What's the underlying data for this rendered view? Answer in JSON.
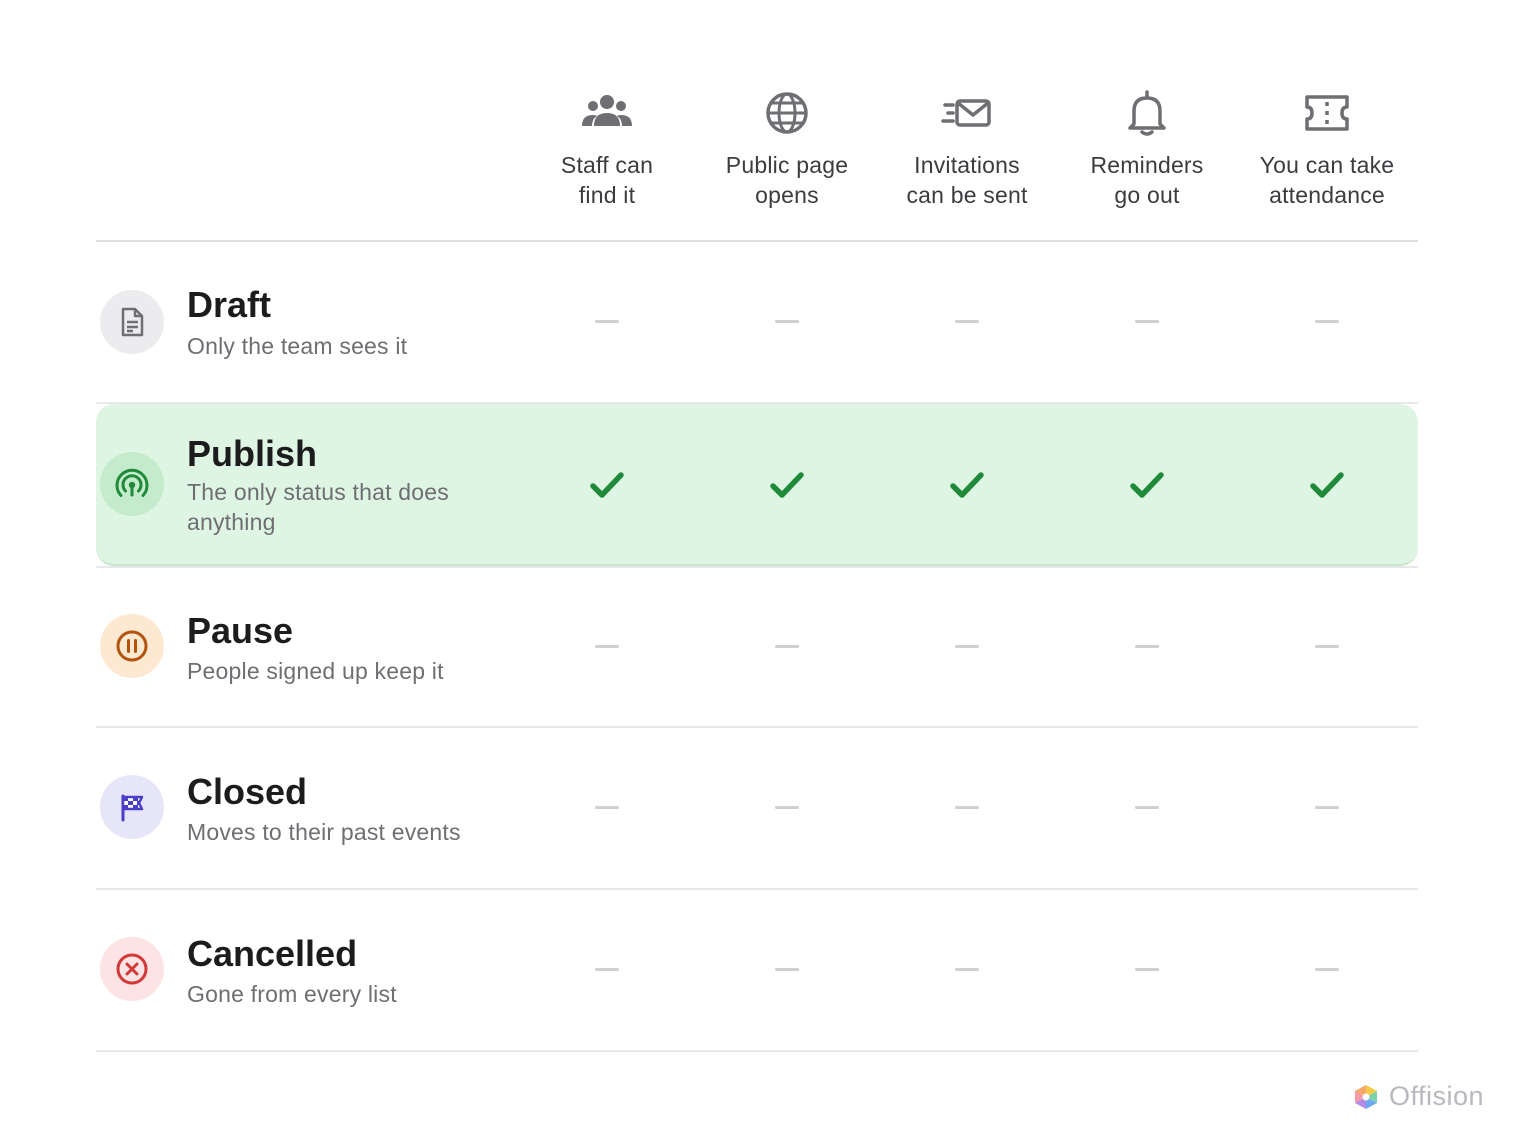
{
  "columns": [
    {
      "label_line1": "Staff can",
      "label_line2": "find it",
      "icon": "people-icon"
    },
    {
      "label_line1": "Public page",
      "label_line2": "opens",
      "icon": "globe-icon"
    },
    {
      "label_line1": "Invitations",
      "label_line2": "can be sent",
      "icon": "mail-send-icon"
    },
    {
      "label_line1": "Reminders",
      "label_line2": "go out",
      "icon": "bell-icon"
    },
    {
      "label_line1": "You can take",
      "label_line2": "attendance",
      "icon": "ticket-icon"
    }
  ],
  "rows": [
    {
      "name": "Draft",
      "description": "Only the team sees it",
      "icon": "document-icon",
      "icon_color": "#6e6e73",
      "icon_bg": "#ececee",
      "values": [
        false,
        false,
        false,
        false,
        false
      ],
      "highlighted": false
    },
    {
      "name": "Publish",
      "description": "The only status that does anything",
      "icon": "broadcast-icon",
      "icon_color": "#1f8a3a",
      "icon_bg": "#c4ebcc",
      "values": [
        true,
        true,
        true,
        true,
        true
      ],
      "highlighted": true
    },
    {
      "name": "Pause",
      "description": "People signed up keep it",
      "icon": "pause-icon",
      "icon_color": "#b3540e",
      "icon_bg": "#fde9d2",
      "values": [
        false,
        false,
        false,
        false,
        false
      ],
      "highlighted": false
    },
    {
      "name": "Closed",
      "description": "Moves to their past events",
      "icon": "checkered-flag-icon",
      "icon_color": "#4a3fc9",
      "icon_bg": "#e7e6f8",
      "values": [
        false,
        false,
        false,
        false,
        false
      ],
      "highlighted": false
    },
    {
      "name": "Cancelled",
      "description": "Gone from every list",
      "icon": "cancel-circle-icon",
      "icon_color": "#d23a3a",
      "icon_bg": "#fde3e3",
      "values": [
        false,
        false,
        false,
        false,
        false
      ],
      "highlighted": false
    }
  ],
  "colors": {
    "check": "#1f8a3a",
    "dash": "#cfcfd3",
    "highlight_bg": "#dff5e3"
  },
  "brand": {
    "name": "Offision"
  }
}
